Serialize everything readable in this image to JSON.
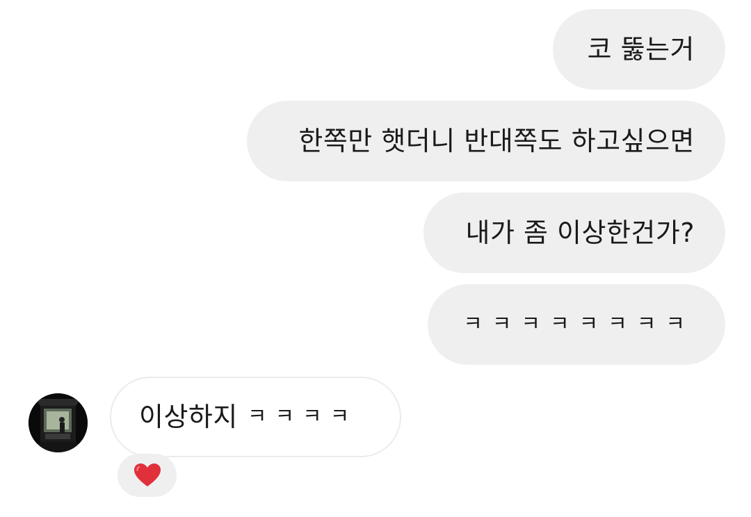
{
  "messages": {
    "outgoing": [
      {
        "text": "코 뚫는거"
      },
      {
        "text": "한쪽만 햇더니 반대쪽도 하고싶으면"
      },
      {
        "text": "내가 좀 이상한건가?"
      },
      {
        "text": "ㅋㅋㅋㅋㅋㅋㅋㅋ"
      }
    ],
    "incoming": [
      {
        "text": "이상하지",
        "laugh": "ㅋㅋㅋㅋ",
        "reaction": "heart"
      }
    ]
  },
  "colors": {
    "outgoing_bubble": "#efefef",
    "incoming_border": "#ebebeb",
    "reaction_heart": "#e0303a"
  }
}
